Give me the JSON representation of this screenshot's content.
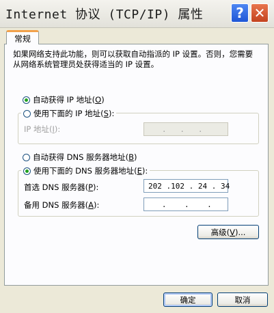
{
  "window": {
    "title": "Internet 协议 (TCP/IP) 属性",
    "help_label": "?",
    "close_label": "✕"
  },
  "tabs": [
    {
      "label": "常规"
    }
  ],
  "general": {
    "description": "如果网络支持此功能，则可以获取自动指派的 IP 设置。否则，您需要从网络系统管理员处获得适当的 IP 设置。",
    "ip_auto_label": "自动获得 IP 地址",
    "ip_auto_key": "O",
    "ip_manual_label": "使用下面的 IP 地址",
    "ip_manual_key": "S",
    "ip_address_label": "IP 地址",
    "ip_address_key": "I",
    "ip_address_value": "   .   .   .   ",
    "dns_auto_label": "自动获得 DNS 服务器地址",
    "dns_auto_key": "B",
    "dns_manual_label": "使用下面的 DNS 服务器地址",
    "dns_manual_key": "E",
    "preferred_dns_label": "首选 DNS 服务器",
    "preferred_dns_key": "P",
    "preferred_dns_value": "202 .102 . 24 . 34",
    "alternate_dns_label": "备用 DNS 服务器",
    "alternate_dns_key": "A",
    "alternate_dns_value": "   .    .    .   ",
    "advanced_label": "高级",
    "advanced_key": "V",
    "advanced_suffix": "..."
  },
  "footer": {
    "ok_label": "确定",
    "cancel_label": "取消"
  },
  "colors": {
    "dialog_bg": "#ECE9D8",
    "tab_accent": "#F2A14A",
    "radio_dot": "#21A121",
    "button_border": "#003C74"
  }
}
